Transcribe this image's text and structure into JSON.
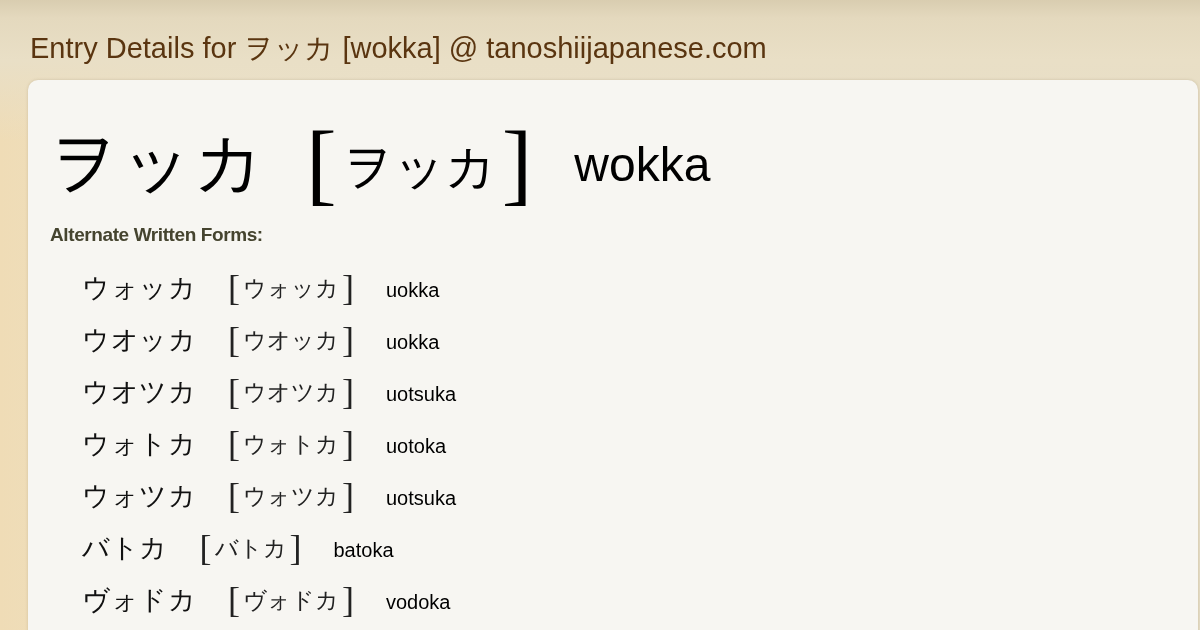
{
  "page_title": "Entry Details for ヲッカ [wokka] @ tanoshiijapanese.com",
  "entry": {
    "word": "ヲッカ",
    "bracket_open": "[",
    "reading": "ヲッカ",
    "bracket_close": "]",
    "romaji": "wokka"
  },
  "alternate_forms": {
    "heading": "Alternate Written Forms:",
    "items": [
      {
        "word": "ウォッカ",
        "bracket_open": "[",
        "reading": "ウォッカ",
        "bracket_close": "]",
        "romaji": "uokka"
      },
      {
        "word": "ウオッカ",
        "bracket_open": "[",
        "reading": "ウオッカ",
        "bracket_close": "]",
        "romaji": "uokka"
      },
      {
        "word": "ウオツカ",
        "bracket_open": "[",
        "reading": "ウオツカ",
        "bracket_close": "]",
        "romaji": "uotsuka"
      },
      {
        "word": "ウォトカ",
        "bracket_open": "[",
        "reading": "ウォトカ",
        "bracket_close": "]",
        "romaji": "uotoka"
      },
      {
        "word": "ウォツカ",
        "bracket_open": "[",
        "reading": "ウォツカ",
        "bracket_close": "]",
        "romaji": "uotsuka"
      },
      {
        "word": "バトカ",
        "bracket_open": "[",
        "reading": "バトカ",
        "bracket_close": "]",
        "romaji": "batoka"
      },
      {
        "word": "ヴォドカ",
        "bracket_open": "[",
        "reading": "ヴォドカ",
        "bracket_close": "]",
        "romaji": "vodoka"
      }
    ]
  }
}
